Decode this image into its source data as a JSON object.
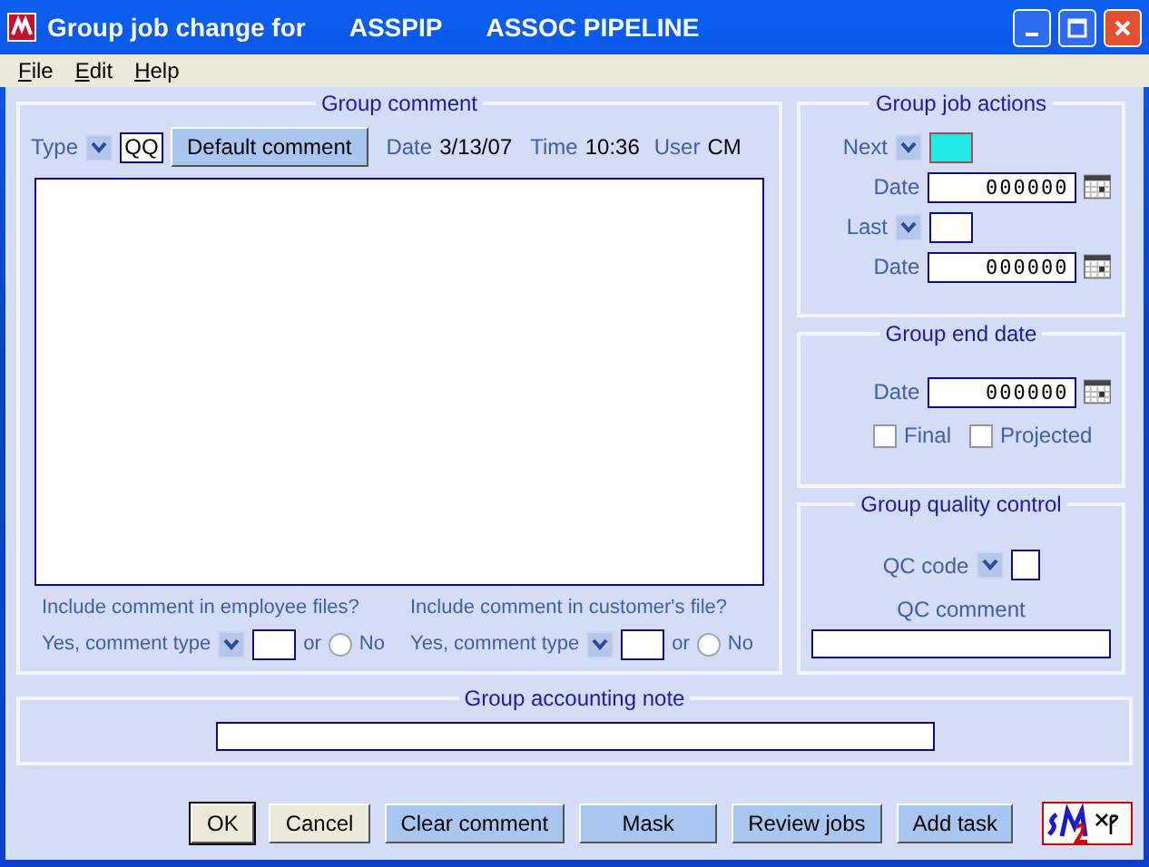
{
  "window": {
    "title": "Group job change for",
    "code": "ASSPIP",
    "name": "ASSOC PIPELINE"
  },
  "menu": [
    {
      "label": "File"
    },
    {
      "label": "Edit"
    },
    {
      "label": "Help"
    }
  ],
  "group_comment": {
    "title": "Group comment",
    "type_label": "Type",
    "type_value": "QQ",
    "default_button": "Default comment",
    "date_label": "Date",
    "date_value": "3/13/07",
    "time_label": "Time",
    "time_value": "10:36",
    "user_label": "User",
    "user_value": "CM",
    "includes": [
      {
        "question": "Include comment in employee files?",
        "yes_label": "Yes, comment type",
        "or_label": "or",
        "no_label": "No",
        "no_selected": false
      },
      {
        "question": "Include comment in customer's file?",
        "yes_label": "Yes, comment type",
        "or_label": "or",
        "no_label": "No",
        "no_selected": false
      }
    ]
  },
  "group_job_actions": {
    "title": "Group job actions",
    "rows": [
      {
        "label": "Next",
        "focused": true,
        "date_label": "Date",
        "date_value": "000000"
      },
      {
        "label": "Last",
        "focused": false,
        "date_label": "Date",
        "date_value": "000000"
      }
    ]
  },
  "group_end_date": {
    "title": "Group end date",
    "date_label": "Date",
    "date_value": "000000",
    "checkboxes": [
      {
        "label": "Final",
        "checked": false
      },
      {
        "label": "Projected",
        "checked": false
      }
    ]
  },
  "group_quality_control": {
    "title": "Group quality control",
    "code_label": "QC code",
    "comment_label": "QC comment"
  },
  "group_accounting_note": {
    "title": "Group accounting note"
  },
  "buttons": [
    {
      "label": "OK",
      "kind": "plain",
      "default": true
    },
    {
      "label": "Cancel",
      "kind": "plain",
      "default": false
    },
    {
      "label": "Clear comment",
      "kind": "blue",
      "default": false
    },
    {
      "label": "Mask",
      "kind": "blue",
      "default": false
    },
    {
      "label": "Review jobs",
      "kind": "blue",
      "default": false
    },
    {
      "label": "Add task",
      "kind": "blue",
      "default": false
    }
  ]
}
